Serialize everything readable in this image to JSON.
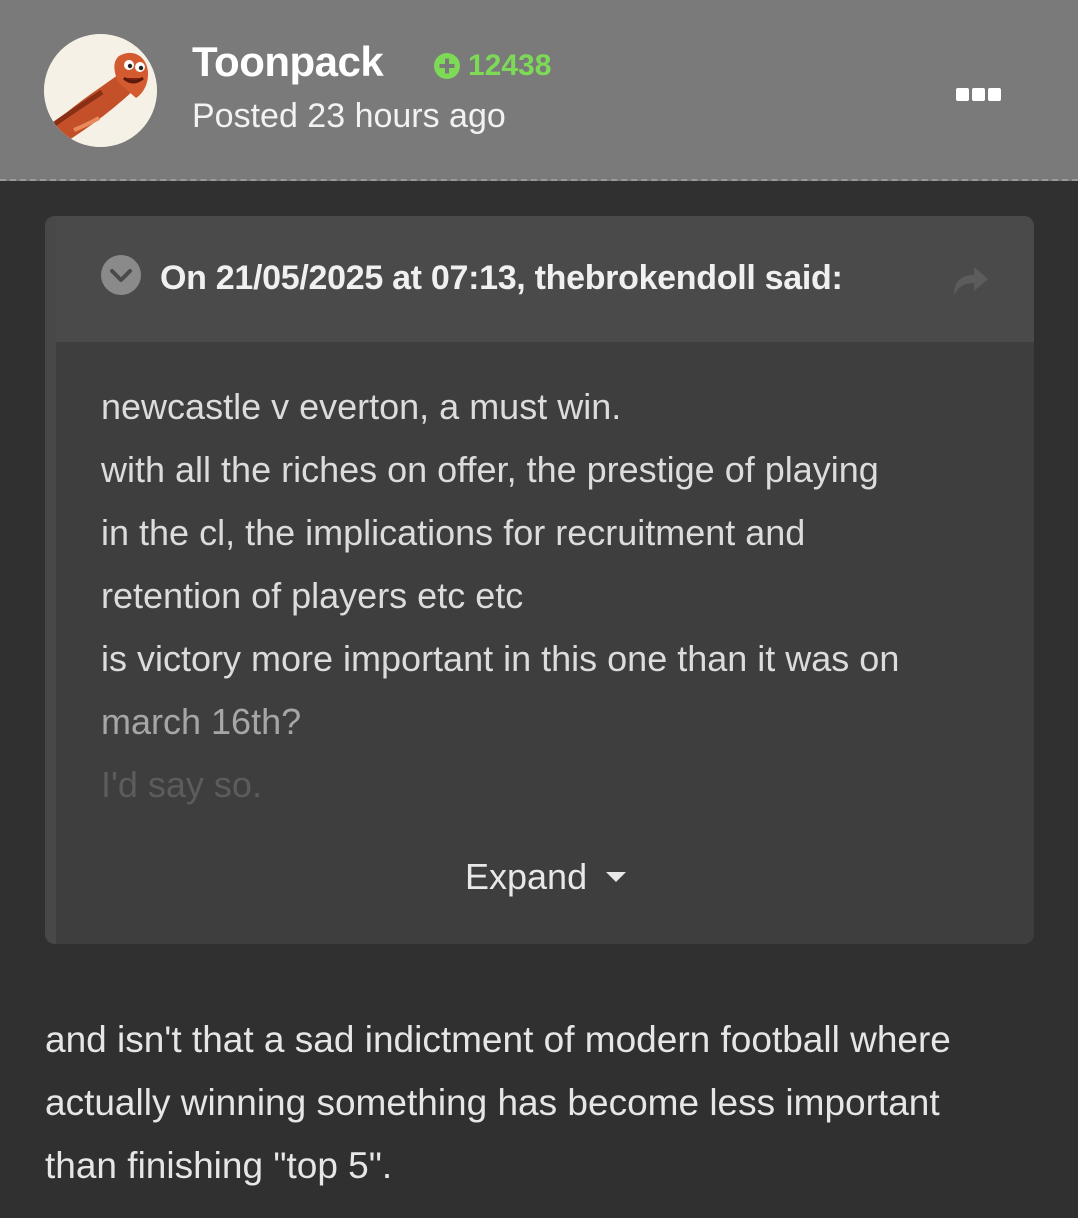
{
  "author": {
    "name": "Toonpack",
    "reputation": "12438",
    "posted": "Posted 23 hours ago",
    "avatar_icon": "sausage-avatar-icon"
  },
  "header": {
    "menu_icon": "more-options-icon"
  },
  "quote": {
    "citation": "On 21/05/2025 at 07:13, thebrokendoll said:",
    "lines": [
      "newcastle v everton, a must win.",
      "with all the riches on offer, the prestige of playing",
      "in the cl, the implications for recruitment and",
      "retention of players etc etc",
      "is victory more important in this one than it was on",
      "march 16th?",
      "I'd say so."
    ],
    "expand_label": "Expand"
  },
  "post": {
    "lines": [
      "and isn't that a sad indictment of modern football where",
      "actually winning something has become less important",
      "than finishing \"top 5\"."
    ]
  },
  "colors": {
    "background": "#303030",
    "header": "#7a7a7a",
    "quote_bg": "#3e3e3e",
    "quote_header_bg": "#4a4a4a",
    "reputation": "#7ed957"
  }
}
